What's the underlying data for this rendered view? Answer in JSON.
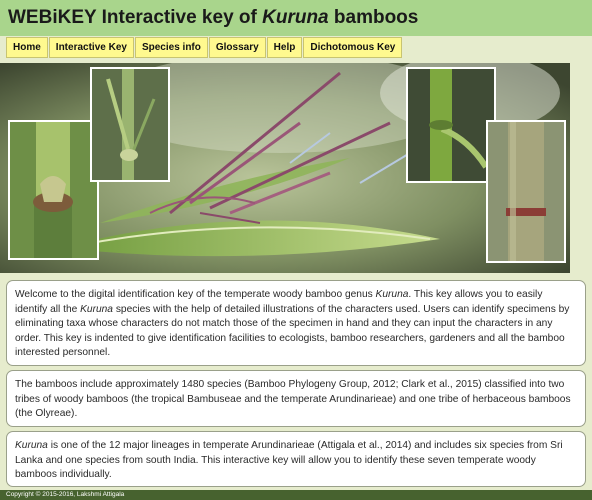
{
  "header": {
    "title_prefix": "WEBiKEY Interactive key of ",
    "title_genus": "Kuruna",
    "title_suffix": " bamboos"
  },
  "nav": {
    "items": [
      {
        "label": "Home"
      },
      {
        "label": "Interactive Key"
      },
      {
        "label": "Species info"
      },
      {
        "label": "Glossary"
      },
      {
        "label": "Help"
      },
      {
        "label": "Dichotomous Key"
      }
    ]
  },
  "intro": {
    "p1_a": "Welcome to the digital identification key of the temperate woody bamboo genus ",
    "p1_b": "Kuruna",
    "p1_c": ". This key allows you to easily identify all the ",
    "p1_d": "Kuruna",
    "p1_e": " species with the help of detailed illustrations of the characters used. Users can identify specimens by eliminating taxa whose characters do not match those of the specimen in hand and they can input the characters in any order. This key is indented to give identification facilities to ecologists, bamboo researchers, gardeners and all the bamboo interested personnel."
  },
  "bamboos": {
    "text": "The bamboos include approximately 1480 species (Bamboo Phylogeny Group, 2012; Clark et al., 2015) classified into two tribes of woody bamboos (the tropical Bambuseae and the temperate Arundinarieae) and one tribe of herbaceous bamboos (the Olyreae)."
  },
  "kuruna": {
    "genus": "Kuruna",
    "text": " is one of the 12 major lineages in temperate Arundinarieae (Attigala et al., 2014) and includes six species from Sri Lanka and one species from south India. This interactive key will allow you to identify these seven temperate woody bamboos individually."
  },
  "footer": {
    "copyright": "Copyright © 2015-2016, Lakshmi Attigala"
  }
}
